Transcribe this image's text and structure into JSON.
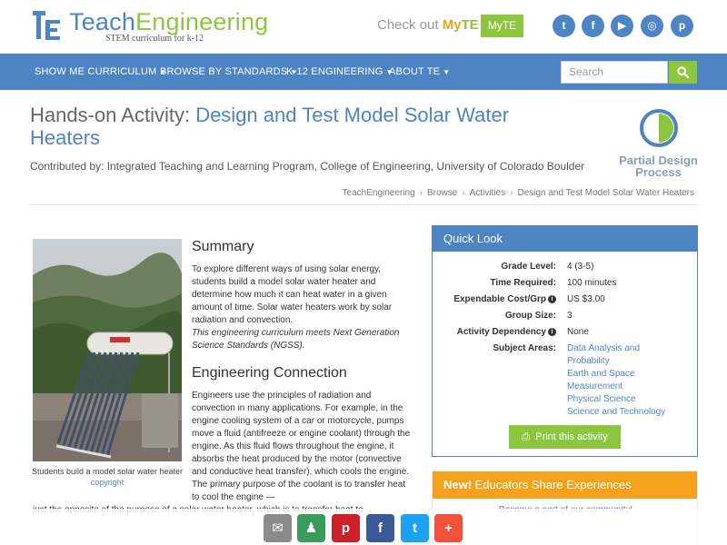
{
  "header": {
    "logo_part1": "Teach",
    "logo_part2": "Engineering",
    "logo_subtitle": "STEM curriculum for k-12",
    "checkout_text": "Check out",
    "myte_my": "My",
    "myte_te": "TE",
    "myte_button": "MyTE",
    "social": [
      {
        "name": "twitter-icon",
        "glyph": "t"
      },
      {
        "name": "facebook-icon",
        "glyph": "f"
      },
      {
        "name": "youtube-icon",
        "glyph": "▶"
      },
      {
        "name": "instagram-icon",
        "glyph": "◎"
      },
      {
        "name": "pinterest-icon",
        "glyph": "p"
      }
    ]
  },
  "nav": {
    "items": [
      {
        "label": "SHOW ME CURRICULUM"
      },
      {
        "label": "BROWSE BY STANDARDS"
      },
      {
        "label": "K-12 ENGINEERING"
      },
      {
        "label": "ABOUT TE"
      }
    ],
    "search_placeholder": "Search",
    "search_icon": "search-icon"
  },
  "title": {
    "prefix": "Hands-on Activity: ",
    "main": "Design and Test Model Solar Water Heaters"
  },
  "contributed": "Contributed by: Integrated Teaching and Learning Program, College of Engineering, University of Colorado Boulder",
  "design_badge": {
    "line1": "Partial Design",
    "line2": "Process"
  },
  "breadcrumb": [
    "TeachEngineering",
    "Browse",
    "Activities",
    "Design and Test Model Solar Water Heaters"
  ],
  "photo": {
    "caption": "Students build a model solar water heater",
    "credit": "copyright"
  },
  "summary": {
    "heading": "Summary",
    "body": "To explore different ways of using solar energy, students build a model solar water heater and determine how much it can heat water in a given amount of time. Solar water heaters work by solar radiation and convection.",
    "ngss": "This engineering curriculum meets Next Generation Science Standards (NGSS)."
  },
  "engineering": {
    "heading": "Engineering Connection",
    "body": "Engineers use the principles of radiation and convection in many applications. For example, in the engine cooling system of a car or motorcycle, pumps move a fluid (antifreeze or engine coolant) through the engine. As this fluid flows throughout the engine, it absorbs the heat produced by the motor (convective and conductive heat transfer), which cools the engine. The primary purpose of the coolant is to transfer heat to cool the engine —",
    "continued": "just the opposite of the purpose of a solar water heater, which is to transfer heat to"
  },
  "quick_look": {
    "heading": "Quick Look",
    "rows": [
      {
        "label": "Grade Level:",
        "value": "4 (3-5)"
      },
      {
        "label": "Time Required:",
        "value": "100 minutes"
      },
      {
        "label": "Expendable Cost/Grp",
        "value": "US $3.00"
      },
      {
        "label": "Group Size:",
        "value": "3"
      },
      {
        "label": "Activity Dependency",
        "value": "None"
      },
      {
        "label": "Subject Areas:",
        "value": ""
      }
    ],
    "subjects": [
      "Data Analysis and",
      "Probability",
      "Earth and Space",
      "Measurement",
      "Physical Science",
      "Science and Technology"
    ],
    "print_label": "Print this activity"
  },
  "educators": {
    "new": "New!",
    "heading": " Educators Share Experiences",
    "link": "Become a part of our community!"
  },
  "share_bar": [
    {
      "name": "email-share-button",
      "glyph": "✉",
      "color": "#8b8b8b"
    },
    {
      "name": "classroom-share-button",
      "glyph": "♟",
      "color": "#3a9c5b"
    },
    {
      "name": "pinterest-share-button",
      "glyph": "p",
      "color": "#cb2027"
    },
    {
      "name": "facebook-share-button",
      "glyph": "f",
      "color": "#3b5998"
    },
    {
      "name": "twitter-share-button",
      "glyph": "t",
      "color": "#1da1f2"
    },
    {
      "name": "more-share-button",
      "glyph": "+",
      "color": "#f0523a"
    }
  ],
  "colors": {
    "brand_blue": "#4f84c4",
    "brand_green": "#8cc63f",
    "accent_orange": "#f4a21d"
  }
}
